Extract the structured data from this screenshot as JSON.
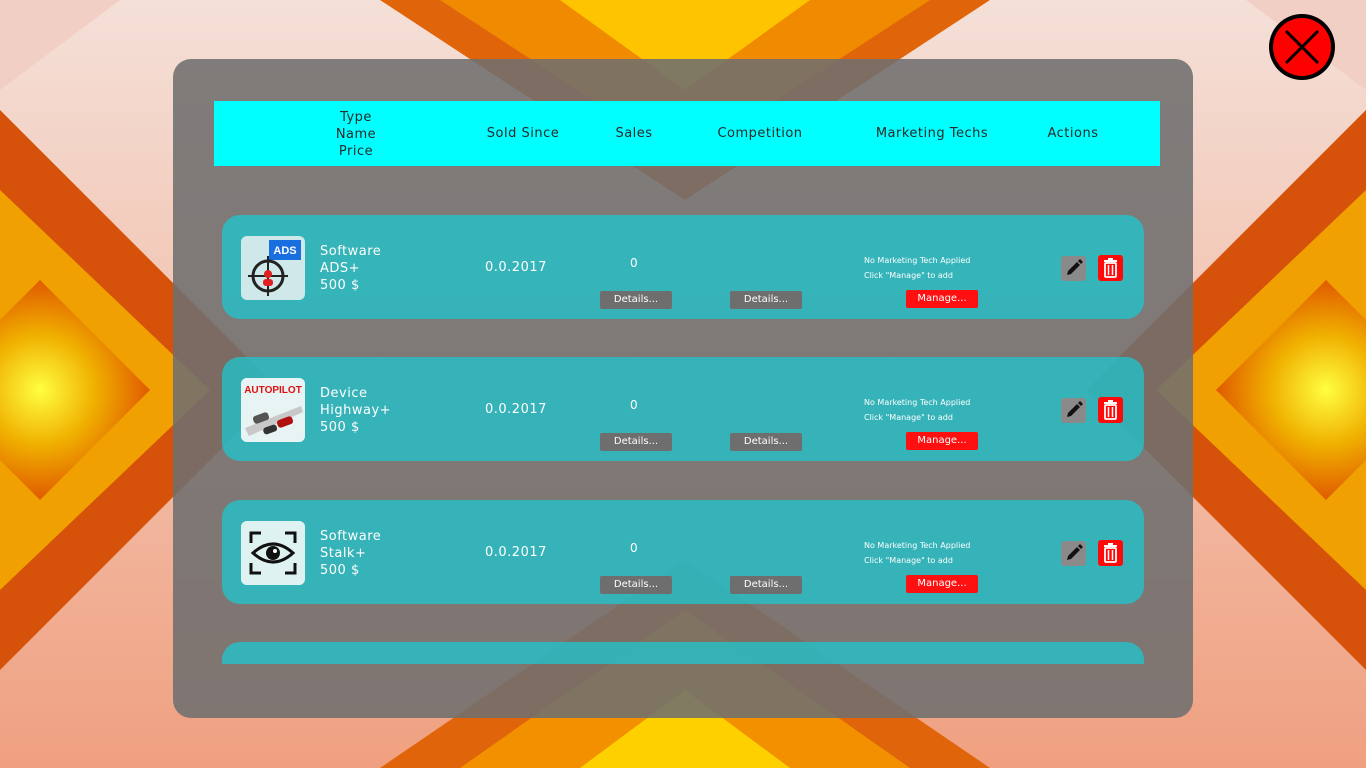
{
  "window": {
    "close_icon": "close-x-icon",
    "accent": "#ff0000"
  },
  "header": {
    "type_lines": [
      "Type",
      "Name",
      "Price"
    ],
    "sold_since": "Sold Since",
    "sales": "Sales",
    "competition": "Competition",
    "marketing_techs": "Marketing Techs",
    "actions": "Actions",
    "color": "#00ffff"
  },
  "products": [
    {
      "type": "Software",
      "name": "ADS+",
      "price": "500 $",
      "sold_since": "0.0.2017",
      "sales": "0",
      "sales_details": "Details...",
      "competition_details": "Details...",
      "marketing_status": "No Marketing Tech Applied",
      "marketing_hint": "Click \"Manage\" to add",
      "manage": "Manage...",
      "icon": "ads-target-icon",
      "icon_text": "ADS"
    },
    {
      "type": "Device",
      "name": "Highway+",
      "price": "500 $",
      "sold_since": "0.0.2017",
      "sales": "0",
      "sales_details": "Details...",
      "competition_details": "Details...",
      "marketing_status": "No Marketing Tech Applied",
      "marketing_hint": "Click \"Manage\" to add",
      "manage": "Manage...",
      "icon": "autopilot-car-icon",
      "icon_text": "AUTOPILOT"
    },
    {
      "type": "Software",
      "name": "Stalk+",
      "price": "500 $",
      "sold_since": "0.0.2017",
      "sales": "0",
      "sales_details": "Details...",
      "competition_details": "Details...",
      "marketing_status": "No Marketing Tech Applied",
      "marketing_hint": "Click \"Manage\" to add",
      "manage": "Manage...",
      "icon": "eye-scan-icon"
    }
  ],
  "action_icons": {
    "edit": "pencil-icon",
    "delete": "trash-icon"
  },
  "colors": {
    "row": "#20c4cc",
    "manage": "#ff1010",
    "details": "#6e6e6e",
    "panel": "#6e6e6e"
  }
}
